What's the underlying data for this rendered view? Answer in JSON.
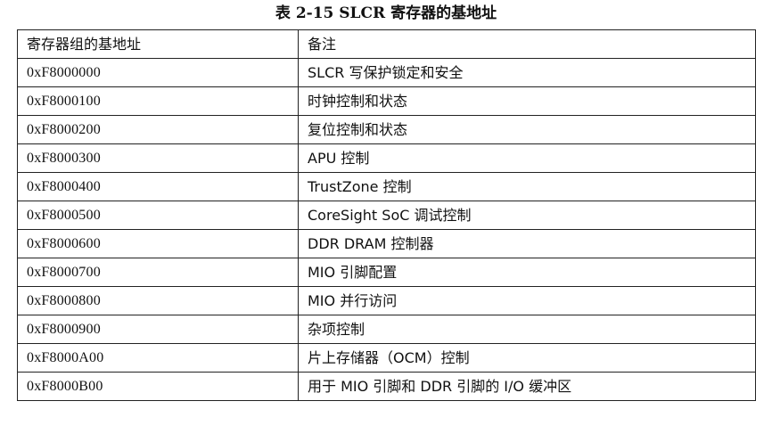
{
  "caption": "表 2-15 SLCR 寄存器的基地址",
  "table": {
    "headers": [
      "寄存器组的基地址",
      "备注"
    ],
    "rows": [
      {
        "address": "0xF8000000",
        "note": "SLCR 写保护锁定和安全"
      },
      {
        "address": "0xF8000100",
        "note": "时钟控制和状态"
      },
      {
        "address": "0xF8000200",
        "note": "复位控制和状态"
      },
      {
        "address": "0xF8000300",
        "note": "APU 控制"
      },
      {
        "address": "0xF8000400",
        "note": "TrustZone 控制"
      },
      {
        "address": "0xF8000500",
        "note": "CoreSight SoC 调试控制"
      },
      {
        "address": "0xF8000600",
        "note": "DDR DRAM 控制器"
      },
      {
        "address": "0xF8000700",
        "note": "MIO 引脚配置"
      },
      {
        "address": "0xF8000800",
        "note": "MIO 并行访问"
      },
      {
        "address": "0xF8000900",
        "note": "杂项控制"
      },
      {
        "address": "0xF8000A00",
        "note": "片上存储器（OCM）控制"
      },
      {
        "address": "0xF8000B00",
        "note": "用于 MIO 引脚和 DDR 引脚的 I/O 缓冲区"
      }
    ]
  }
}
